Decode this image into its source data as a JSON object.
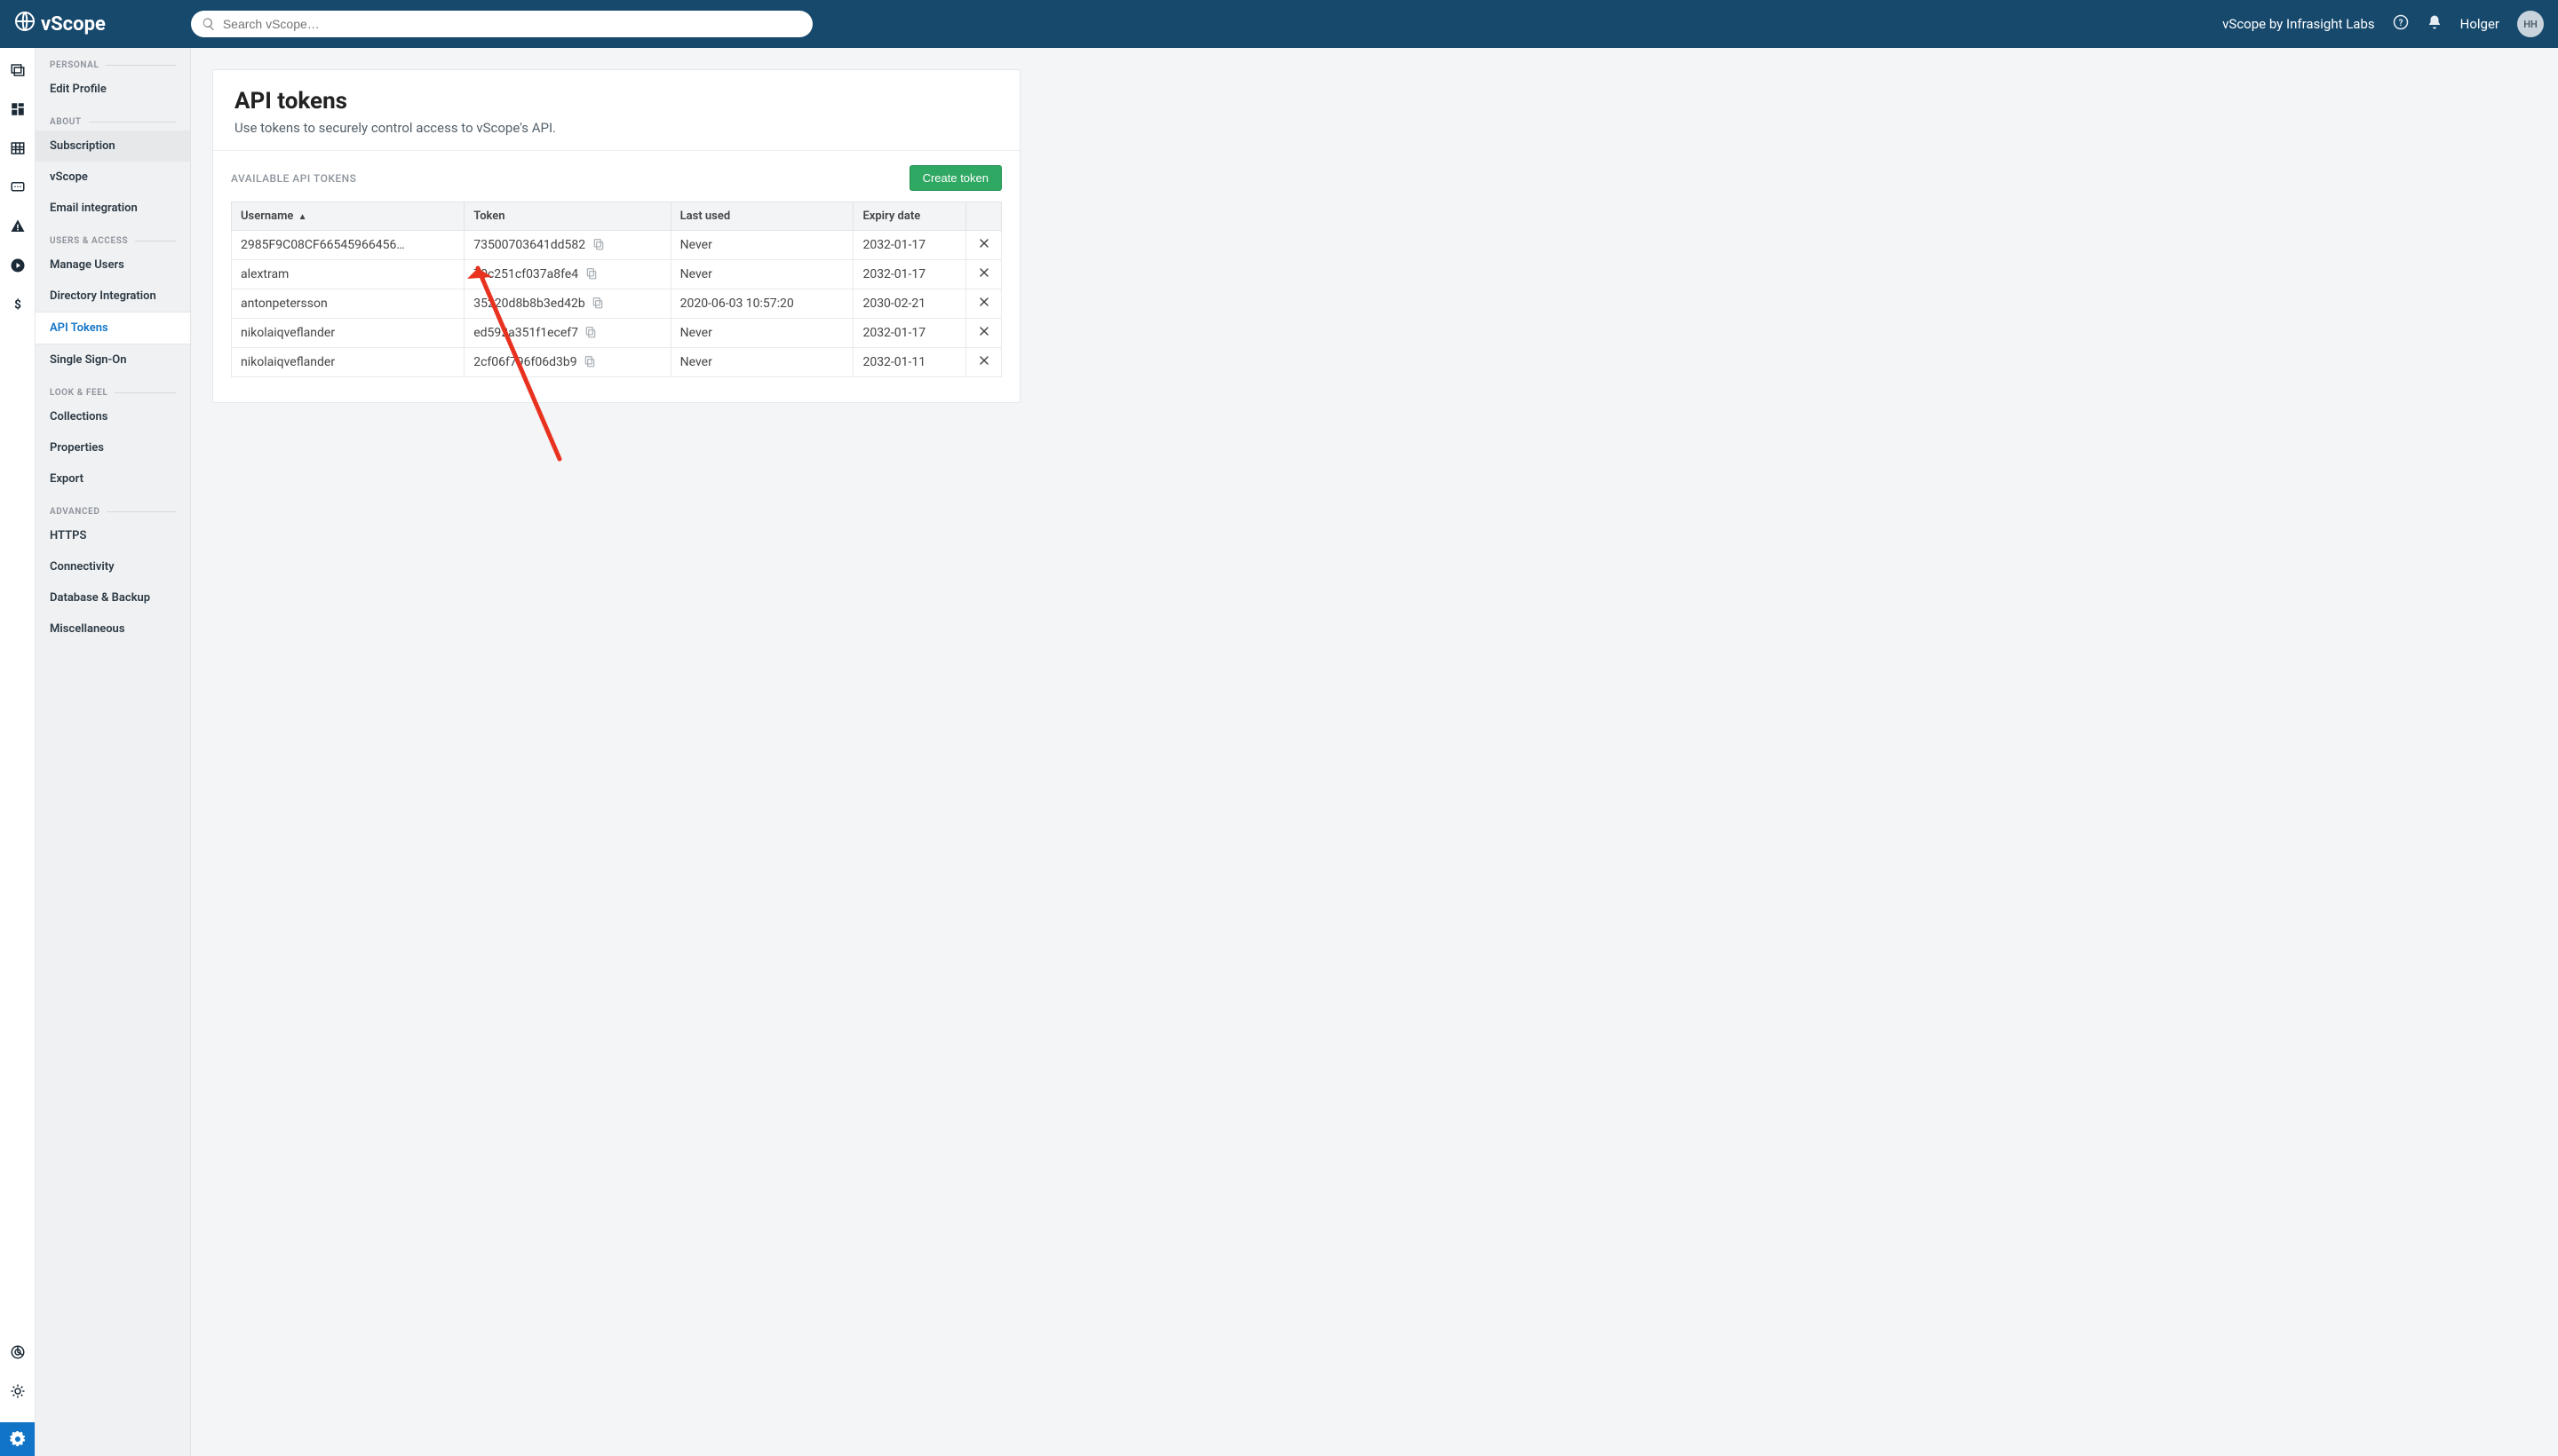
{
  "brand": "vScope",
  "search": {
    "placeholder": "Search vScope…"
  },
  "topbar": {
    "tagline": "vScope by Infrasight Labs",
    "user_name": "Holger",
    "user_initials": "HH"
  },
  "sidebar": {
    "groups": [
      {
        "title": "PERSONAL",
        "items": [
          {
            "label": "Edit Profile"
          }
        ]
      },
      {
        "title": "ABOUT",
        "items": [
          {
            "label": "Subscription",
            "highlight": true
          },
          {
            "label": "vScope"
          },
          {
            "label": "Email integration"
          }
        ]
      },
      {
        "title": "USERS & ACCESS",
        "items": [
          {
            "label": "Manage Users"
          },
          {
            "label": "Directory Integration"
          },
          {
            "label": "API Tokens",
            "current": true
          },
          {
            "label": "Single Sign-On"
          }
        ]
      },
      {
        "title": "LOOK & FEEL",
        "items": [
          {
            "label": "Collections"
          },
          {
            "label": "Properties"
          },
          {
            "label": "Export"
          }
        ]
      },
      {
        "title": "ADVANCED",
        "items": [
          {
            "label": "HTTPS"
          },
          {
            "label": "Connectivity"
          },
          {
            "label": "Database & Backup"
          },
          {
            "label": "Miscellaneous"
          }
        ]
      }
    ]
  },
  "page": {
    "title": "API tokens",
    "subtitle": "Use tokens to securely control access to vScope's API.",
    "section_title": "AVAILABLE API TOKENS",
    "create_label": "Create token",
    "columns": {
      "username": "Username",
      "token": "Token",
      "last_used": "Last used",
      "expiry": "Expiry date"
    },
    "rows": [
      {
        "username": "2985F9C08CF66545966456…",
        "token": "73500703641dd582",
        "last_used": "Never",
        "expiry": "2032-01-17"
      },
      {
        "username": "alextram",
        "token": "70c251cf037a8fe4",
        "last_used": "Never",
        "expiry": "2032-01-17"
      },
      {
        "username": "antonpetersson",
        "token": "35220d8b8b3ed42b",
        "last_used": "2020-06-03 10:57:20",
        "expiry": "2030-02-21"
      },
      {
        "username": "nikolaiqveflander",
        "token": "ed592a351f1ecef7",
        "last_used": "Never",
        "expiry": "2032-01-17"
      },
      {
        "username": "nikolaiqveflander",
        "token": "2cf06f796f06d3b9",
        "last_used": "Never",
        "expiry": "2032-01-11"
      }
    ]
  }
}
